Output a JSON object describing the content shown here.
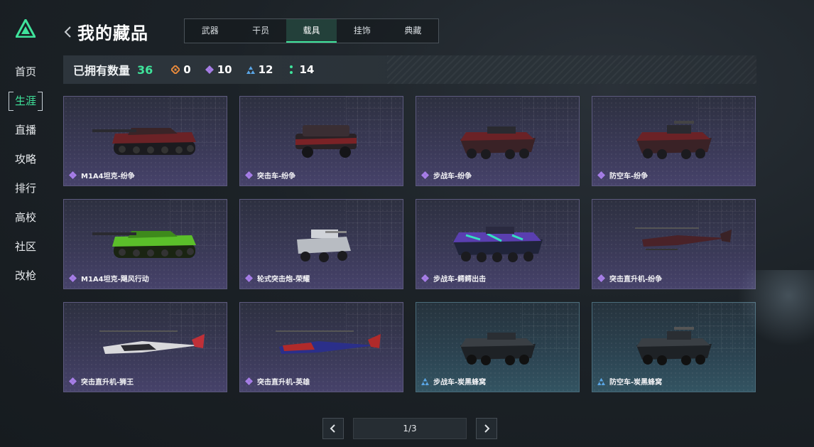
{
  "sidebar": {
    "logo": "triangle-logo",
    "items": [
      {
        "label": "首页",
        "active": false
      },
      {
        "label": "生涯",
        "active": true
      },
      {
        "label": "直播",
        "active": false
      },
      {
        "label": "攻略",
        "active": false
      },
      {
        "label": "排行",
        "active": false
      },
      {
        "label": "高校",
        "active": false
      },
      {
        "label": "社区",
        "active": false
      },
      {
        "label": "改枪",
        "active": false
      }
    ]
  },
  "header": {
    "title": "我的藏品",
    "back_icon": "chevron-left-icon",
    "tabs": [
      {
        "label": "武器",
        "active": false
      },
      {
        "label": "干员",
        "active": false
      },
      {
        "label": "载具",
        "active": true
      },
      {
        "label": "挂饰",
        "active": false
      },
      {
        "label": "典藏",
        "active": false
      }
    ]
  },
  "stats": {
    "label": "已拥有数量",
    "total": "36",
    "items": [
      {
        "icon": "orange-diamond-icon",
        "value": "0",
        "color": "#e88a3c"
      },
      {
        "icon": "purple-diamond-icon",
        "value": "10",
        "color": "#a77ee8"
      },
      {
        "icon": "blue-triangle-icon",
        "value": "12",
        "color": "#5aa6e6"
      },
      {
        "icon": "green-dots-icon",
        "value": "14",
        "color": "#3fe39b"
      }
    ]
  },
  "colors": {
    "accent": "#3fe39b",
    "rarity_purple": "#a77ee8",
    "rarity_blue": "#5aa6e6"
  },
  "cards": [
    {
      "name": "M1A4坦克-纷争",
      "rarity": "purple",
      "vehicle": "tank"
    },
    {
      "name": "突击车-纷争",
      "rarity": "purple",
      "vehicle": "assault-car"
    },
    {
      "name": "步战车-纷争",
      "rarity": "purple",
      "vehicle": "ifv"
    },
    {
      "name": "防空车-纷争",
      "rarity": "purple",
      "vehicle": "aa-vehicle"
    },
    {
      "name": "M1A4坦克-飓风行动",
      "rarity": "purple",
      "vehicle": "tank"
    },
    {
      "name": "轮式突击炮-荣耀",
      "rarity": "purple",
      "vehicle": "wheeled-gun"
    },
    {
      "name": "步战车-鳄鳄出击",
      "rarity": "purple",
      "vehicle": "ifv"
    },
    {
      "name": "突击直升机-纷争",
      "rarity": "purple",
      "vehicle": "helicopter"
    },
    {
      "name": "突击直升机-狮王",
      "rarity": "purple",
      "vehicle": "helicopter"
    },
    {
      "name": "突击直升机-英雄",
      "rarity": "purple",
      "vehicle": "helicopter"
    },
    {
      "name": "步战车-炭黑蜂窝",
      "rarity": "blue",
      "vehicle": "ifv"
    },
    {
      "name": "防空车-炭黑蜂窝",
      "rarity": "blue",
      "vehicle": "aa-vehicle"
    }
  ],
  "pager": {
    "text": "1/3",
    "prev_icon": "chevron-left-icon",
    "next_icon": "chevron-right-icon"
  }
}
